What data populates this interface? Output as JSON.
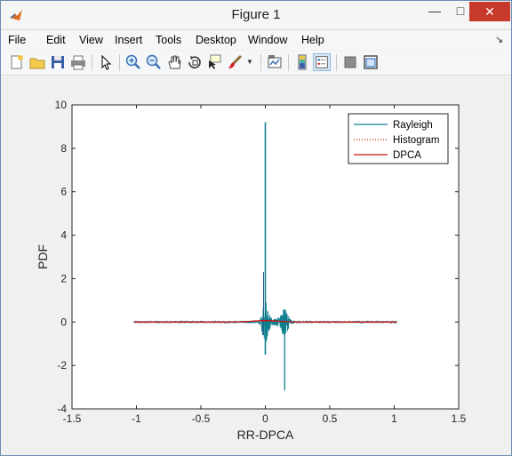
{
  "window": {
    "title": "Figure 1"
  },
  "menu": [
    "File",
    "Edit",
    "View",
    "Insert",
    "Tools",
    "Desktop",
    "Window",
    "Help"
  ],
  "toolbar": {
    "icons": [
      "new-figure-icon",
      "open-file-icon",
      "save-icon",
      "print-icon",
      "edit-plot-arrow-icon",
      "zoom-in-icon",
      "zoom-out-icon",
      "pan-hand-icon",
      "rotate-3d-icon",
      "data-cursor-icon",
      "brush-icon",
      "brush-dropdown-icon",
      "link-plot-icon",
      "insert-colorbar-icon",
      "insert-legend-icon",
      "hide-plot-tools-icon",
      "show-plot-tools-icon"
    ]
  },
  "colors": {
    "teal": "#0f7f8f",
    "red": "#cc1111",
    "close_button": "#c7392b"
  },
  "chart_data": {
    "type": "line",
    "title": "",
    "xlabel": "RR-DPCA",
    "ylabel": "PDF",
    "xlim": [
      -1.5,
      1.5
    ],
    "ylim": [
      -4,
      10
    ],
    "xticks": [
      "-1.5",
      "-1",
      "-0.5",
      "0",
      "0.5",
      "1",
      "1.5"
    ],
    "yticks": [
      "-4",
      "-2",
      "0",
      "2",
      "4",
      "6",
      "8",
      "10"
    ],
    "x_range": [
      -1.02,
      1.02
    ],
    "grid": false,
    "legend_position": "top-right",
    "series": [
      {
        "name": "Rayleigh",
        "style": "solid",
        "color": "#0f7f8f",
        "peak": [
          0.0,
          9.2
        ],
        "trough": [
          0.15,
          -3.15
        ]
      },
      {
        "name": "Histogram",
        "style": "dotted",
        "color": "#cc1111"
      },
      {
        "name": "DPCA",
        "style": "solid",
        "color": "#cc1111"
      }
    ]
  }
}
